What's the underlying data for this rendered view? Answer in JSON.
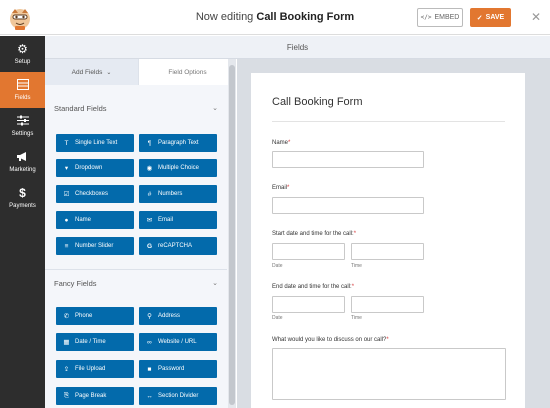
{
  "topbar": {
    "editing_prefix": "Now editing",
    "form_name": "Call Booking Form",
    "embed_label": "EMBED",
    "save_label": "SAVE"
  },
  "sidebar": {
    "items": [
      {
        "label": "Setup",
        "icon": "gear-icon"
      },
      {
        "label": "Fields",
        "icon": "fields-icon"
      },
      {
        "label": "Settings",
        "icon": "sliders-icon"
      },
      {
        "label": "Marketing",
        "icon": "megaphone-icon"
      },
      {
        "label": "Payments",
        "icon": "dollar-icon"
      }
    ],
    "active": "Fields"
  },
  "header": {
    "title": "Fields"
  },
  "panel": {
    "tabs": [
      "Add Fields",
      "Field Options"
    ],
    "standard": {
      "title": "Standard Fields",
      "buttons": [
        "Single Line Text",
        "Paragraph Text",
        "Dropdown",
        "Multiple Choice",
        "Checkboxes",
        "Numbers",
        "Name",
        "Email",
        "Number Slider",
        "reCAPTCHA"
      ]
    },
    "fancy": {
      "title": "Fancy Fields",
      "buttons": [
        "Phone",
        "Address",
        "Date / Time",
        "Website / URL",
        "File Upload",
        "Password",
        "Page Break",
        "Section Divider"
      ]
    }
  },
  "form": {
    "title": "Call Booking Form",
    "fields": {
      "name": "Name",
      "email": "Email",
      "start": "Start date and time for the call:",
      "end": "End date and time for the call:",
      "discuss": "What would you like to discuss on our call?",
      "date": "Date",
      "time": "Time",
      "required_mark": "*"
    }
  }
}
